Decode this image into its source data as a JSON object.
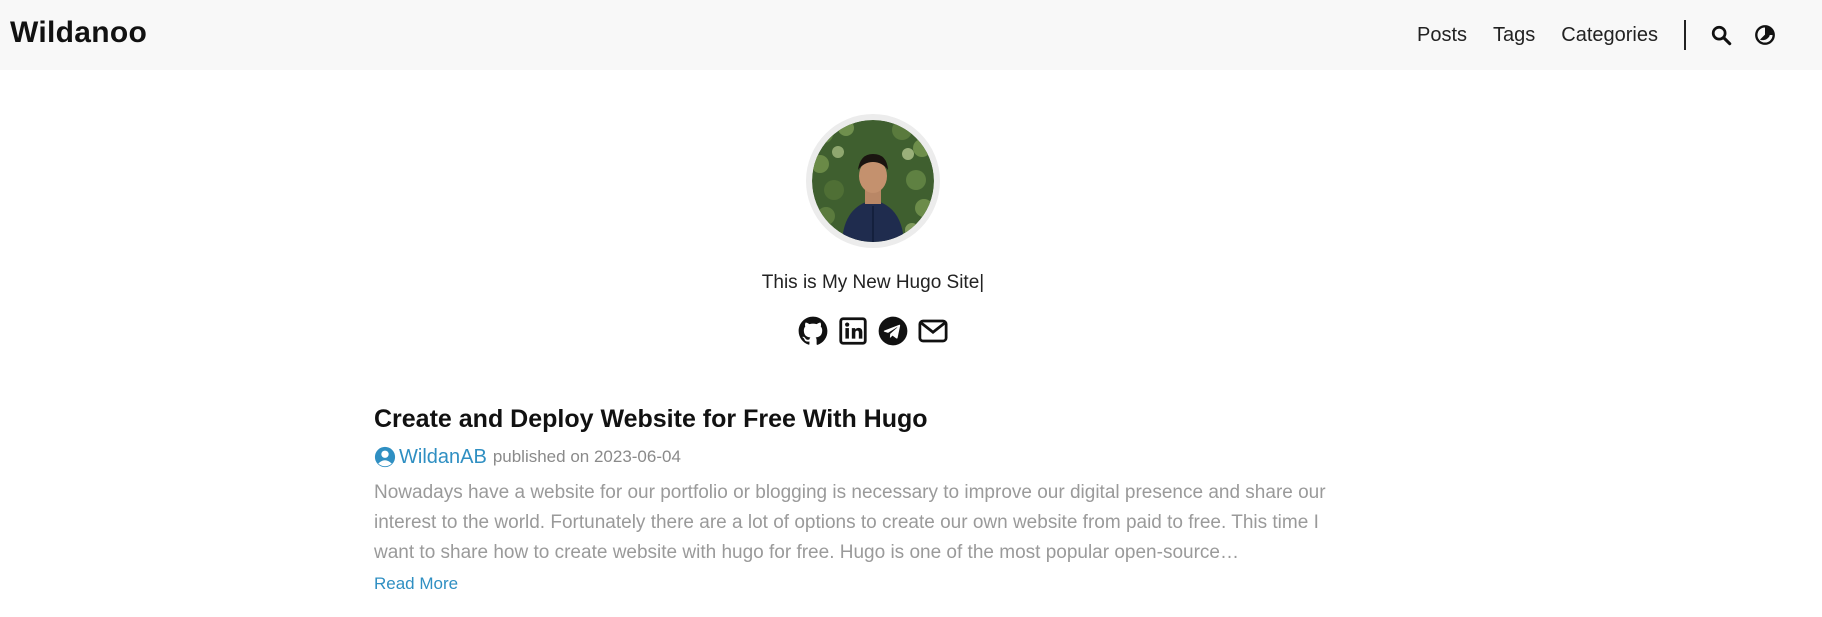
{
  "site": {
    "brand": "Wildanoo",
    "nav": [
      {
        "label": "Posts"
      },
      {
        "label": "Tags"
      },
      {
        "label": "Categories"
      }
    ],
    "icons": [
      "search-icon",
      "theme-toggle-icon"
    ]
  },
  "profile": {
    "subtitle": "This is My New Hugo Site|",
    "social_icons": [
      "github-icon",
      "linkedin-icon",
      "telegram-icon",
      "email-icon"
    ]
  },
  "post": {
    "title": "Create and Deploy Website for Free With Hugo",
    "author": "WildanAB",
    "published_label": "published on 2023-06-04",
    "summary": "Nowadays have a website for our portfolio or blogging is necessary to improve our digital presence and share our interest to the world. Fortunately there are a lot of options to create our own website from paid to free. This time I want to share how to create website with hugo for free. Hugo is one of the most popular open-source…",
    "read_more": "Read More"
  },
  "colors": {
    "accent": "#2f8fc2",
    "navbar_bg": "#f8f8f8",
    "muted_text": "#9a9a9a"
  }
}
